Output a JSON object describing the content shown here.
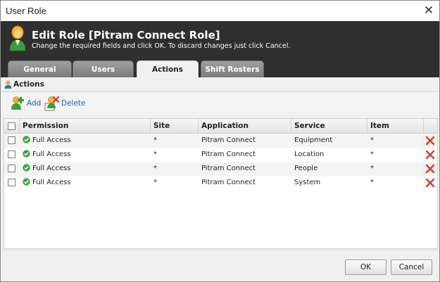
{
  "window": {
    "title": "User Role",
    "close_glyph": "✕"
  },
  "header": {
    "title": "Edit Role [Pitram Connect Role]",
    "subtitle": "Change the required fields and click OK. To discard changes just click Cancel.",
    "icon": "user-icon"
  },
  "tabs": [
    {
      "label": "General",
      "active": false
    },
    {
      "label": "Users",
      "active": false
    },
    {
      "label": "Actions",
      "active": true
    },
    {
      "label": "Shift Rosters",
      "active": false
    }
  ],
  "section": {
    "title": "Actions",
    "icon": "user-icon"
  },
  "toolbar": {
    "add_label": "Add",
    "delete_label": "Delete"
  },
  "grid": {
    "columns": [
      "Permission",
      "Site",
      "Application",
      "Service",
      "Item"
    ],
    "rows": [
      {
        "permission": "Full Access",
        "site": "*",
        "application": "Pitram Connect",
        "service": "Equipment",
        "item": "*"
      },
      {
        "permission": "Full Access",
        "site": "*",
        "application": "Pitram Connect",
        "service": "Location",
        "item": "*"
      },
      {
        "permission": "Full Access",
        "site": "*",
        "application": "Pitram Connect",
        "service": "People",
        "item": "*"
      },
      {
        "permission": "Full Access",
        "site": "*",
        "application": "Pitram Connect",
        "service": "System",
        "item": "*"
      }
    ]
  },
  "footer": {
    "ok_label": "OK",
    "cancel_label": "Cancel"
  },
  "colors": {
    "header_bg": "#2f2f2f",
    "link": "#1f5fae",
    "delete": "#d33b2c",
    "check": "#3aa83a"
  }
}
